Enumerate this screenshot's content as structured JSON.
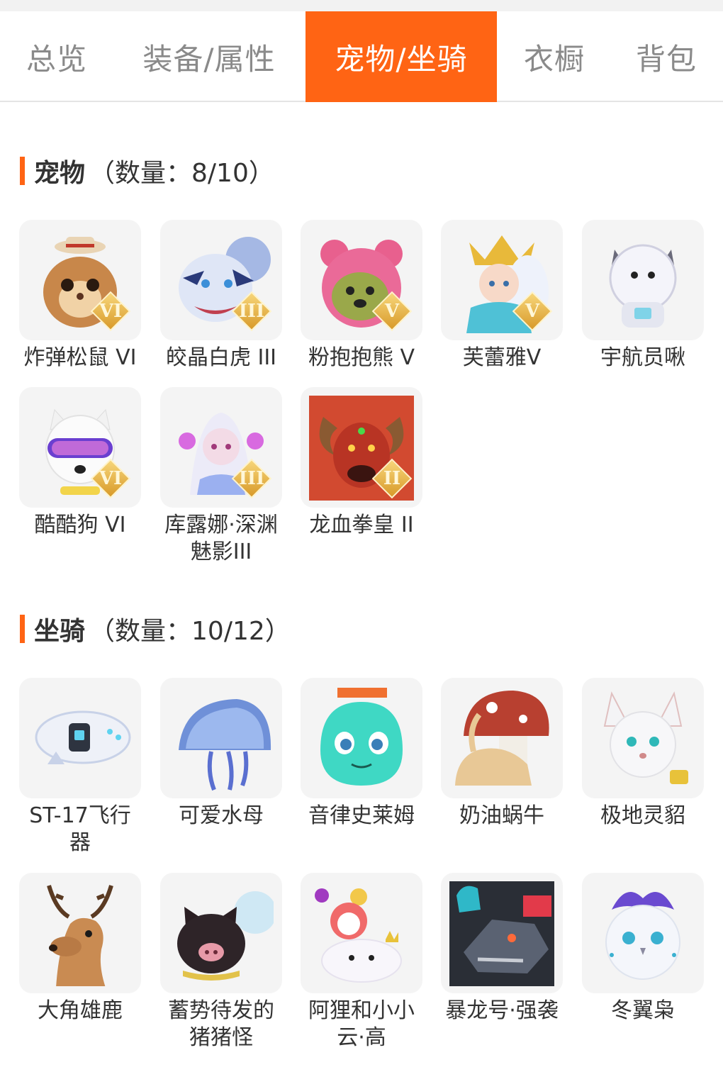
{
  "tabs": [
    {
      "label": "总览"
    },
    {
      "label": "装备/属性"
    },
    {
      "label": "宠物/坐骑"
    },
    {
      "label": "衣橱"
    },
    {
      "label": "背包"
    }
  ],
  "active_tab": "宠物/坐骑",
  "colors": {
    "accent": "#ff6414",
    "tab_inactive": "#8a8a8a",
    "thumb_bg": "#f4f4f4"
  },
  "pets": {
    "title": "宠物",
    "count": "（数量：8/10）",
    "items": [
      {
        "label": "炸弹松鼠 VI",
        "badge": "VI",
        "icon": "squirrel-icon"
      },
      {
        "label": "皎晶白虎 III",
        "badge": "III",
        "icon": "white-tiger-icon"
      },
      {
        "label": "粉抱抱熊 V",
        "badge": "V",
        "icon": "pink-bear-icon"
      },
      {
        "label": "芙蕾雅V",
        "badge": "V",
        "icon": "freya-icon"
      },
      {
        "label": "宇航员啾",
        "badge": "",
        "icon": "astronaut-icon"
      },
      {
        "label": "酷酷狗 VI",
        "badge": "VI",
        "icon": "cool-dog-icon"
      },
      {
        "label": "库露娜·深渊魅影III",
        "badge": "III",
        "icon": "kuluna-icon"
      },
      {
        "label": "龙血拳皇 II",
        "badge": "II",
        "icon": "dragon-blood-icon"
      }
    ]
  },
  "mounts": {
    "title": "坐骑",
    "count": "（数量：10/12）",
    "items": [
      {
        "label": "ST-17飞行器",
        "icon": "aircraft-icon"
      },
      {
        "label": "可爱水母",
        "icon": "jellyfish-icon"
      },
      {
        "label": "音律史莱姆",
        "icon": "slime-icon"
      },
      {
        "label": "奶油蜗牛",
        "icon": "snail-icon"
      },
      {
        "label": "极地灵貂",
        "icon": "polar-mink-icon"
      },
      {
        "label": "大角雄鹿",
        "icon": "stag-icon"
      },
      {
        "label": "蓄势待发的猪猪怪",
        "icon": "pig-icon"
      },
      {
        "label": "阿狸和小小云·高",
        "icon": "ali-cloud-icon"
      },
      {
        "label": "暴龙号·强袭",
        "icon": "mecha-dragon-icon"
      },
      {
        "label": "冬翼枭",
        "icon": "owl-icon"
      }
    ]
  }
}
